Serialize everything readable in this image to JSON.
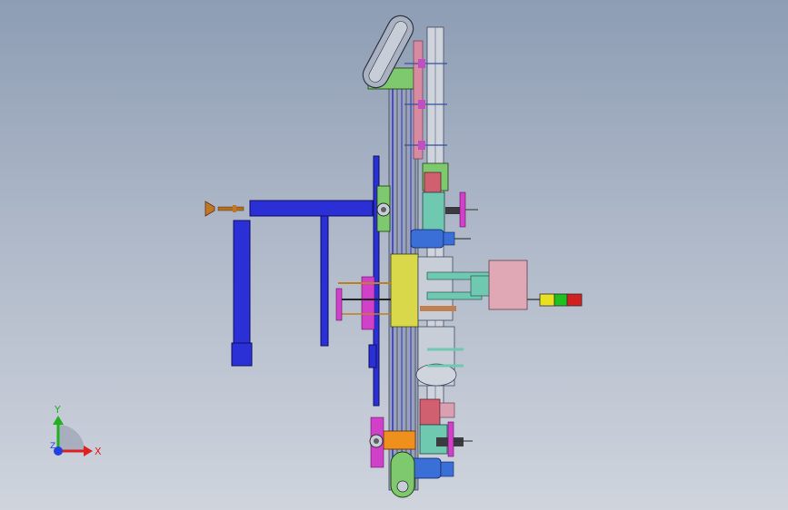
{
  "viewport": {
    "background_top": "#8d9db4",
    "background_bottom": "#cfd4dd"
  },
  "triad": {
    "x_label": "X",
    "y_label": "Y",
    "z_label": "Z",
    "x_color": "#e02020",
    "y_color": "#20b020",
    "z_color": "#2040e0"
  },
  "parts": {
    "frame_color": "#2b2fd6",
    "conveyor_color": "#9aa2b5",
    "carriage_color": "#d8d84a",
    "motor_color": "#3a6fd8",
    "signal_tower": {
      "segments": [
        "yellow",
        "green",
        "red"
      ],
      "colors": [
        "#e8e020",
        "#20c020",
        "#d02020"
      ]
    }
  }
}
